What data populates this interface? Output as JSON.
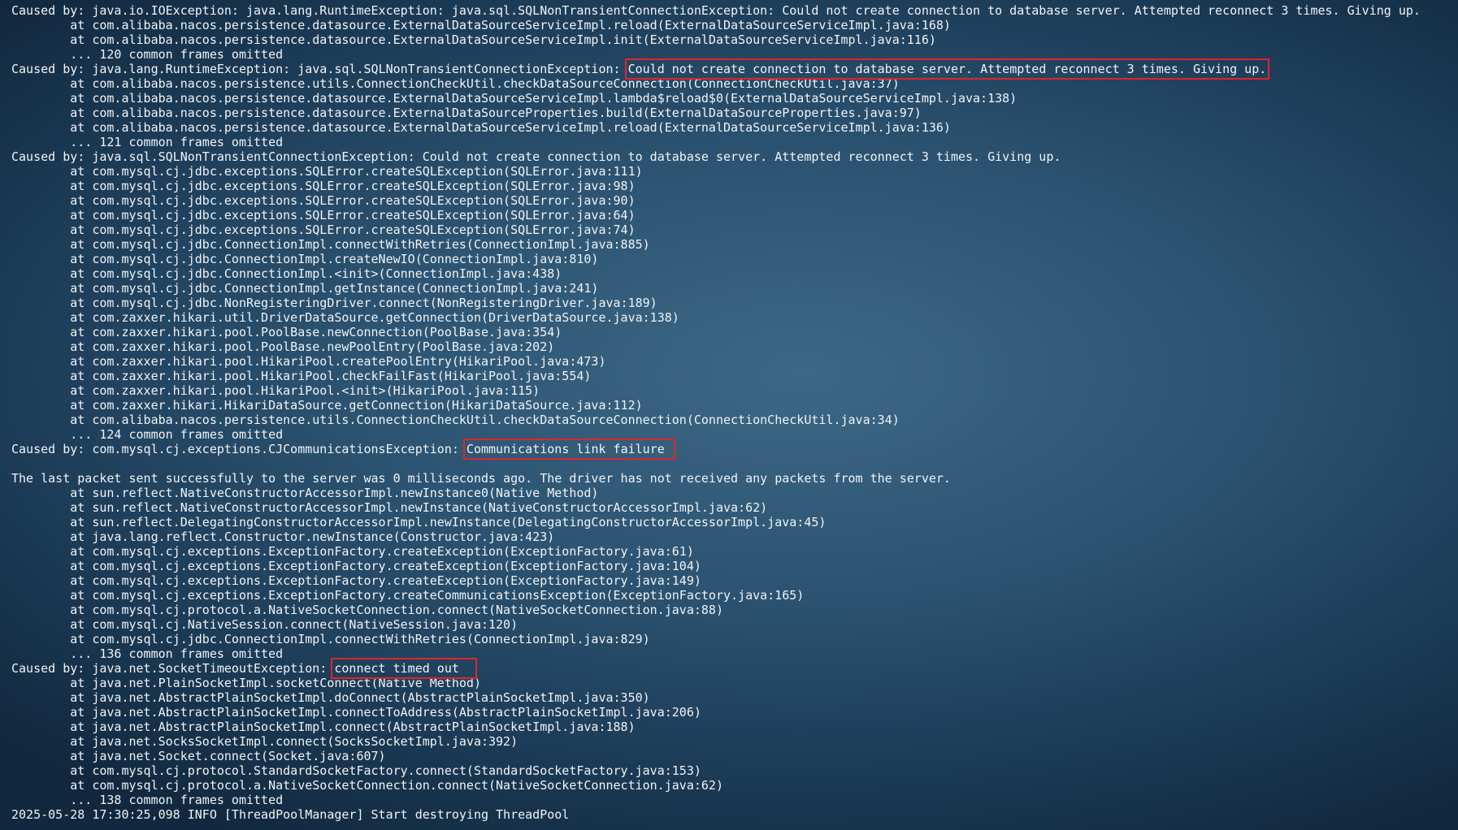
{
  "terminal": {
    "lines": [
      {
        "t": "Caused by: java.io.IOException: java.lang.RuntimeException: java.sql.SQLNonTransientConnectionException: Could not create connection to database server. Attempted reconnect 3 times. Giving up."
      },
      {
        "t": "        at com.alibaba.nacos.persistence.datasource.ExternalDataSourceServiceImpl.reload(ExternalDataSourceServiceImpl.java:168)"
      },
      {
        "t": "        at com.alibaba.nacos.persistence.datasource.ExternalDataSourceServiceImpl.init(ExternalDataSourceServiceImpl.java:116)"
      },
      {
        "t": "        ... 120 common frames omitted"
      },
      {
        "t": "Caused by: java.lang.RuntimeException: java.sql.SQLNonTransientConnectionException: ",
        "h": "Could not create connection to database server. Attempted reconnect 3 times. Giving up."
      },
      {
        "t": "        at com.alibaba.nacos.persistence.utils.ConnectionCheckUtil.checkDataSourceConnection(ConnectionCheckUtil.java:37)"
      },
      {
        "t": "        at com.alibaba.nacos.persistence.datasource.ExternalDataSourceServiceImpl.lambda$reload$0(ExternalDataSourceServiceImpl.java:138)"
      },
      {
        "t": "        at com.alibaba.nacos.persistence.datasource.ExternalDataSourceProperties.build(ExternalDataSourceProperties.java:97)"
      },
      {
        "t": "        at com.alibaba.nacos.persistence.datasource.ExternalDataSourceServiceImpl.reload(ExternalDataSourceServiceImpl.java:136)"
      },
      {
        "t": "        ... 121 common frames omitted"
      },
      {
        "t": "Caused by: java.sql.SQLNonTransientConnectionException: Could not create connection to database server. Attempted reconnect 3 times. Giving up."
      },
      {
        "t": "        at com.mysql.cj.jdbc.exceptions.SQLError.createSQLException(SQLError.java:111)"
      },
      {
        "t": "        at com.mysql.cj.jdbc.exceptions.SQLError.createSQLException(SQLError.java:98)"
      },
      {
        "t": "        at com.mysql.cj.jdbc.exceptions.SQLError.createSQLException(SQLError.java:90)"
      },
      {
        "t": "        at com.mysql.cj.jdbc.exceptions.SQLError.createSQLException(SQLError.java:64)"
      },
      {
        "t": "        at com.mysql.cj.jdbc.exceptions.SQLError.createSQLException(SQLError.java:74)"
      },
      {
        "t": "        at com.mysql.cj.jdbc.ConnectionImpl.connectWithRetries(ConnectionImpl.java:885)"
      },
      {
        "t": "        at com.mysql.cj.jdbc.ConnectionImpl.createNewIO(ConnectionImpl.java:810)"
      },
      {
        "t": "        at com.mysql.cj.jdbc.ConnectionImpl.<init>(ConnectionImpl.java:438)"
      },
      {
        "t": "        at com.mysql.cj.jdbc.ConnectionImpl.getInstance(ConnectionImpl.java:241)"
      },
      {
        "t": "        at com.mysql.cj.jdbc.NonRegisteringDriver.connect(NonRegisteringDriver.java:189)"
      },
      {
        "t": "        at com.zaxxer.hikari.util.DriverDataSource.getConnection(DriverDataSource.java:138)"
      },
      {
        "t": "        at com.zaxxer.hikari.pool.PoolBase.newConnection(PoolBase.java:354)"
      },
      {
        "t": "        at com.zaxxer.hikari.pool.PoolBase.newPoolEntry(PoolBase.java:202)"
      },
      {
        "t": "        at com.zaxxer.hikari.pool.HikariPool.createPoolEntry(HikariPool.java:473)"
      },
      {
        "t": "        at com.zaxxer.hikari.pool.HikariPool.checkFailFast(HikariPool.java:554)"
      },
      {
        "t": "        at com.zaxxer.hikari.pool.HikariPool.<init>(HikariPool.java:115)"
      },
      {
        "t": "        at com.zaxxer.hikari.HikariDataSource.getConnection(HikariDataSource.java:112)"
      },
      {
        "t": "        at com.alibaba.nacos.persistence.utils.ConnectionCheckUtil.checkDataSourceConnection(ConnectionCheckUtil.java:34)"
      },
      {
        "t": "        ... 124 common frames omitted"
      },
      {
        "t": "Caused by: com.mysql.cj.exceptions.CJCommunicationsException: ",
        "h": "Communications link failure "
      },
      {
        "t": ""
      },
      {
        "t": "The last packet sent successfully to the server was 0 milliseconds ago. The driver has not received any packets from the server."
      },
      {
        "t": "        at sun.reflect.NativeConstructorAccessorImpl.newInstance0(Native Method)"
      },
      {
        "t": "        at sun.reflect.NativeConstructorAccessorImpl.newInstance(NativeConstructorAccessorImpl.java:62)"
      },
      {
        "t": "        at sun.reflect.DelegatingConstructorAccessorImpl.newInstance(DelegatingConstructorAccessorImpl.java:45)"
      },
      {
        "t": "        at java.lang.reflect.Constructor.newInstance(Constructor.java:423)"
      },
      {
        "t": "        at com.mysql.cj.exceptions.ExceptionFactory.createException(ExceptionFactory.java:61)"
      },
      {
        "t": "        at com.mysql.cj.exceptions.ExceptionFactory.createException(ExceptionFactory.java:104)"
      },
      {
        "t": "        at com.mysql.cj.exceptions.ExceptionFactory.createException(ExceptionFactory.java:149)"
      },
      {
        "t": "        at com.mysql.cj.exceptions.ExceptionFactory.createCommunicationsException(ExceptionFactory.java:165)"
      },
      {
        "t": "        at com.mysql.cj.protocol.a.NativeSocketConnection.connect(NativeSocketConnection.java:88)"
      },
      {
        "t": "        at com.mysql.cj.NativeSession.connect(NativeSession.java:120)"
      },
      {
        "t": "        at com.mysql.cj.jdbc.ConnectionImpl.connectWithRetries(ConnectionImpl.java:829)"
      },
      {
        "t": "        ... 136 common frames omitted"
      },
      {
        "t": "Caused by: java.net.SocketTimeoutException: ",
        "h": "connect timed out  "
      },
      {
        "t": "        at java.net.PlainSocketImpl.socketConnect(Native Method)"
      },
      {
        "t": "        at java.net.AbstractPlainSocketImpl.doConnect(AbstractPlainSocketImpl.java:350)"
      },
      {
        "t": "        at java.net.AbstractPlainSocketImpl.connectToAddress(AbstractPlainSocketImpl.java:206)"
      },
      {
        "t": "        at java.net.AbstractPlainSocketImpl.connect(AbstractPlainSocketImpl.java:188)"
      },
      {
        "t": "        at java.net.SocksSocketImpl.connect(SocksSocketImpl.java:392)"
      },
      {
        "t": "        at java.net.Socket.connect(Socket.java:607)"
      },
      {
        "t": "        at com.mysql.cj.protocol.StandardSocketFactory.connect(StandardSocketFactory.java:153)"
      },
      {
        "t": "        at com.mysql.cj.protocol.a.NativeSocketConnection.connect(NativeSocketConnection.java:62)"
      },
      {
        "t": "        ... 138 common frames omitted"
      },
      {
        "t": "2025-05-28 17:30:25,098 INFO [ThreadPoolManager] Start destroying ThreadPool"
      }
    ]
  },
  "colors": {
    "text": "#f1f3f5",
    "highlight_box": "#e0242a"
  }
}
